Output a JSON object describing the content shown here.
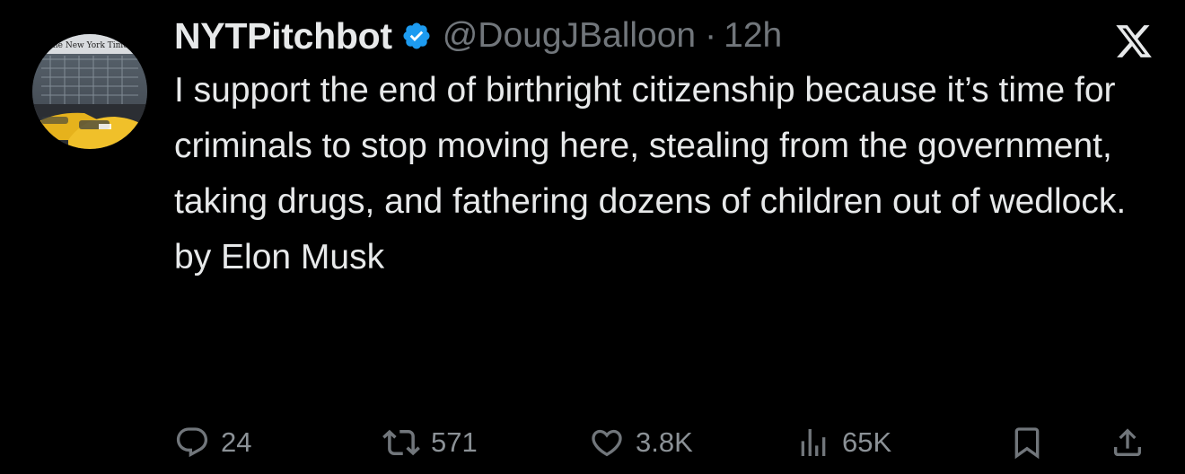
{
  "author": {
    "display_name": "NYTPitchbot",
    "handle": "@DougJBalloon",
    "separator": "·",
    "timestamp": "12h",
    "verified": true,
    "avatar_banner_text": "The New York Times"
  },
  "tweet": {
    "body": "I support the end of birthright citizenship because it’s time for criminals to stop moving here, stealing from the government, taking drugs, and fathering dozens of children out of wedlock.",
    "signature": "by Elon Musk"
  },
  "actions": {
    "replies": "24",
    "reposts": "571",
    "likes": "3.8K",
    "views": "65K"
  },
  "icons": {
    "verified": "verified-badge-icon",
    "platform": "x-logo-icon",
    "reply": "reply-icon",
    "repost": "repost-icon",
    "like": "heart-icon",
    "views": "views-icon",
    "bookmark": "bookmark-icon",
    "share": "share-icon"
  },
  "colors": {
    "background": "#000000",
    "text_primary": "#e7e9ea",
    "text_secondary": "#71767b",
    "verified_blue": "#1d9bf0"
  }
}
